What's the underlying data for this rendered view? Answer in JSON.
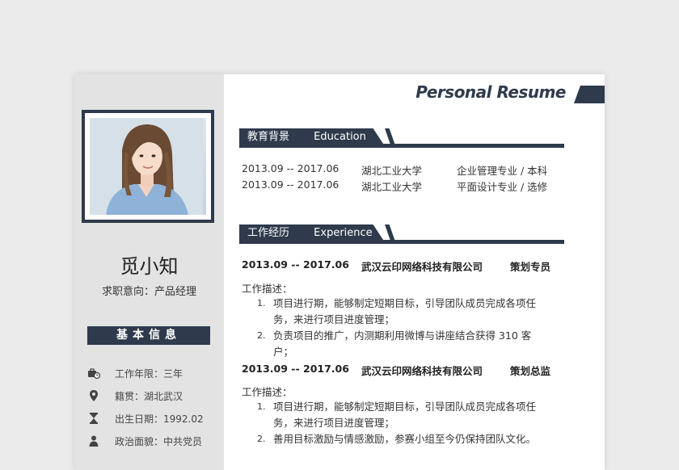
{
  "header": {
    "title": "Personal Resume"
  },
  "profile": {
    "name": "觅小知",
    "intent": "求职意向：产品经理"
  },
  "basic_info": {
    "title": "基本信息",
    "items": [
      {
        "icon": "briefcase-clock-icon",
        "text": "工作年限：三年"
      },
      {
        "icon": "location-pin-icon",
        "text": "籍贯：湖北武汉"
      },
      {
        "icon": "hourglass-icon",
        "text": "出生日期：1992.02"
      },
      {
        "icon": "person-icon",
        "text": "政治面貌：中共党员"
      }
    ]
  },
  "education": {
    "title_cn": "教育背景",
    "title_en": "Education",
    "rows": [
      {
        "period": "2013.09 -- 2017.06",
        "school": "湖北工业大学",
        "major": "企业管理专业  /  本科"
      },
      {
        "period": "2013.09 -- 2017.06",
        "school": "湖北工业大学",
        "major": "平面设计专业  /  选修"
      }
    ]
  },
  "experience": {
    "title_cn": "工作经历",
    "title_en": "Experience",
    "jobs": [
      {
        "period": "2013.09 -- 2017.06",
        "company": "武汉云印网络科技有限公司",
        "role": "策划专员",
        "desc_label": "工作描述：",
        "items": [
          {
            "num": "1.",
            "text": "项目进行期，能够制定短期目标，引导团队成员完成各项任务，来进行项目进度管理；"
          },
          {
            "num": "2.",
            "text": "负责项目的推广，内测期利用微博与讲座结合获得 310 客户；"
          }
        ]
      },
      {
        "period": "2013.09 -- 2017.06",
        "company": "武汉云印网络科技有限公司",
        "role": "策划总监",
        "desc_label": "工作描述：",
        "items": [
          {
            "num": "1.",
            "text": "项目进行期，能够制定短期目标，引导团队成员完成各项任务，来进行项目进度管理；"
          },
          {
            "num": "2.",
            "text": "善用目标激励与情感激励，参赛小组至今仍保持团队文化。"
          }
        ]
      }
    ]
  },
  "colors": {
    "accent": "#2f3b4c",
    "sidebar": "#e3e3e3",
    "page": "#ebebeb"
  }
}
